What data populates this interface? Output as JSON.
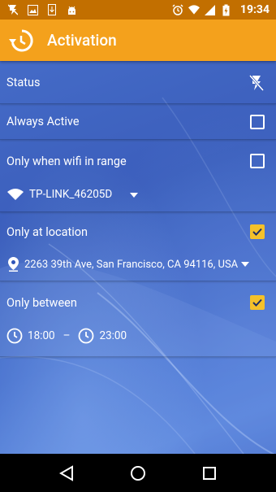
{
  "status_bar": {
    "time": "19:34",
    "battery_icon": "battery-charging-icon",
    "signal_icon": "cell-signal-icon",
    "wifi_icon": "wifi-icon",
    "alarm_icon": "alarm-icon"
  },
  "app_bar": {
    "title": "Activation",
    "icon": "history-icon",
    "color": "#f4a11c"
  },
  "settings": {
    "status": {
      "label": "Status",
      "icon": "flash-off-icon"
    },
    "always_active": {
      "label": "Always Active",
      "checked": false
    },
    "wifi": {
      "label": "Only when wifi in range",
      "checked": false,
      "network": "TP-LINK_46205D"
    },
    "location": {
      "label": "Only at location",
      "checked": true,
      "address": "2263 39th Ave, San Francisco, CA 94116, USA"
    },
    "time_range": {
      "label": "Only between",
      "checked": true,
      "start": "18:00",
      "separator": "–",
      "end": "23:00"
    }
  },
  "colors": {
    "accent_checkbox": "#f4c12a",
    "status_bar": "#c26f00"
  }
}
